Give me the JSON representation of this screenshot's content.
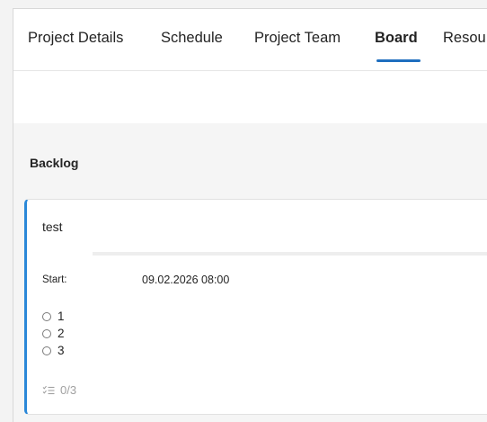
{
  "tabs": [
    {
      "label": "Project Details",
      "active": false
    },
    {
      "label": "Schedule",
      "active": false
    },
    {
      "label": "Project Team",
      "active": false
    },
    {
      "label": "Board",
      "active": true
    },
    {
      "label": "Resou",
      "active": false
    }
  ],
  "colors": {
    "accent": "#1f6fbf",
    "card_border": "#2b88d8",
    "muted": "#a0a0a0"
  },
  "board": {
    "column_title": "Backlog",
    "card": {
      "title": "test",
      "start_label": "Start:",
      "start_value": "09.02.2026 08:00",
      "checklist": [
        {
          "label": "1",
          "checked": false
        },
        {
          "label": "2",
          "checked": false
        },
        {
          "label": "3",
          "checked": false
        }
      ],
      "progress_icon": "checklist-icon",
      "progress_text": "0/3"
    }
  }
}
